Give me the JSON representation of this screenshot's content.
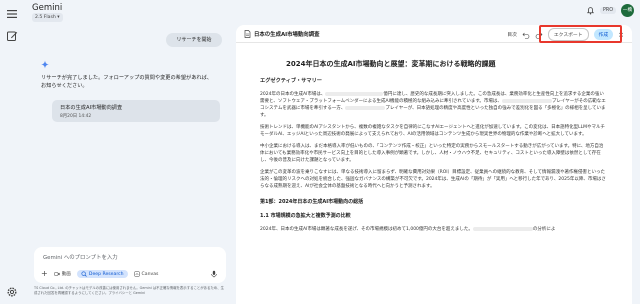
{
  "header": {
    "brand": "Gemini",
    "model": "2.5 Flash ▾",
    "pro_badge": "PRO",
    "avatar_initials": "一橋"
  },
  "chat": {
    "user_message": "リサーチを開始",
    "reply_line1": "リサーチが完了しました。フォローアップの質問や変更の希望があれば、",
    "reply_line2": "お知らせください。",
    "doc_card": {
      "title": "日本の生成AI市場動向調査",
      "date": "8月20日 14:42"
    }
  },
  "input": {
    "placeholder": "Gemini へのプロンプトを入力",
    "tools": [
      "動画",
      "Deep Research",
      "Canvas"
    ]
  },
  "footer": "TS Cloud Co., Ltd. のチャットはモデルの改善には使用されません。Gemini は不正確な情報を表示することがあるため、生成された回答を再確認するようにしてください。プライバシーと Gemini",
  "panel": {
    "title": "日本の生成AI市場動向調査",
    "tools": {
      "toc": "目次",
      "export": "エクスポート",
      "create": "作成"
    },
    "doc_title": "2024年日本の生成AI市場動向と展望：変革期における戦略的課題",
    "exec_summary": "エグゼクティブ・サマリー",
    "p1a": "2024年の日本の生成AI市場は、",
    "p1b": "億円に達し、歴史的な成長期に突入しました。この急成長は、業務効率化と生産性向",
    "p1c": "上を追求する企業の強い需要と、ソフトウェア・プラットフォームベンダーによる生成AI機能の積極的な組み込みに牽引されています。市場は、",
    "p1d": "プレイヤーがその広範なエコシステムを武器に市場を牽引する一方、",
    "p1e": "プレイヤ",
    "p1f": "ーが、日本語処理の精度や高度性といった独自の強みで差別化を図る「多極化」の様相を呈しています。",
    "p2": "技術トレンドは、単機能のAIアシスタントから、複数の複雑なタスクを自律的にこなすAIエージェントへと進化が加速しています。この変化は、日本語特化型LLMやマルチモーダルAI、エッジAIといった周辺技術の発展によって支えられており、AIの活用領域はコンテンツ生成から現実世界の物理的な作業や診断へと拡大しています。",
    "p3": "中小企業における導入は、まだ本格導入率が低いものの、「コンテンツ作成・校正」といった特定の実務からスモールスタートする動きが広がっています。特に、地方自治体においても業務効率化や市民サービス向上を目的とした導入事例が顕著です。しかし、人材・ノウハウ不足、セキュリティ、コストといった導入障壁は依然として存在し、今後の普及に向けた課題となっています。",
    "p4": "企業がこの変革の波を乗りこなすには、単なる技術導入に留まらず、明確な費用対効果（ROI）目標設定、従業員への継続的な教育、そして情報漏洩や著作権侵害といった法的・倫理的リスクへの対処を統合した、強固なガバナンスの構築が不可欠です。2024年は、生成AIの「期待」が「実用」へと移行した年であり、2025年以降、市場はさらなる成熟期を迎え、AIが社会全体の基盤技術となる時代へと向かうと予測されます。",
    "h_part1": "第1部：2024年日本の生成AI市場動向の総括",
    "h_1_1": "1.1 市場規模の急拡大と複数予測の比較",
    "p5a": "2024年、日本の生成AI市場は顕著な成長を遂げ、その市場規模は初めて1,000億円の大台を超えました。",
    "p5b": "の分析によ"
  }
}
